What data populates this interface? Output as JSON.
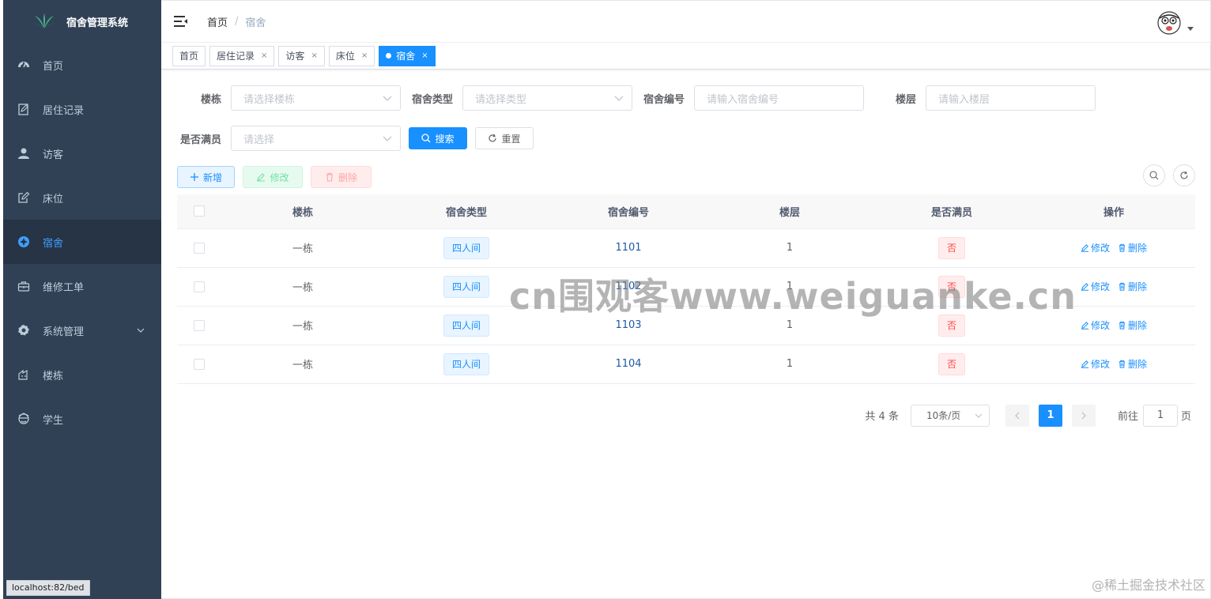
{
  "app": {
    "title": "宿舍管理系统"
  },
  "sidebar": {
    "items": [
      {
        "label": "首页",
        "icon": "dashboard-icon",
        "active": false
      },
      {
        "label": "居住记录",
        "icon": "edit-doc-icon",
        "active": false
      },
      {
        "label": "访客",
        "icon": "user-icon",
        "active": false
      },
      {
        "label": "床位",
        "icon": "edit-icon",
        "active": false
      },
      {
        "label": "宿舍",
        "icon": "dorm-icon",
        "active": true
      },
      {
        "label": "维修工单",
        "icon": "toolbox-icon",
        "active": false
      },
      {
        "label": "系统管理",
        "icon": "gear-icon",
        "active": false,
        "expandable": true
      },
      {
        "label": "楼栋",
        "icon": "building-icon",
        "active": false
      },
      {
        "label": "学生",
        "icon": "student-icon",
        "active": false
      }
    ]
  },
  "status_url": "localhost:82/bed",
  "breadcrumb": {
    "home": "首页",
    "separator": "/",
    "current": "宿舍"
  },
  "tags": [
    {
      "label": "首页",
      "closable": false,
      "active": false
    },
    {
      "label": "居住记录",
      "closable": true,
      "active": false
    },
    {
      "label": "访客",
      "closable": true,
      "active": false
    },
    {
      "label": "床位",
      "closable": true,
      "active": false
    },
    {
      "label": "宿舍",
      "closable": true,
      "active": true
    }
  ],
  "tag_close": "×",
  "search": {
    "building_label": "楼栋",
    "building_placeholder": "请选择楼栋",
    "type_label": "宿舍类型",
    "type_placeholder": "请选择类型",
    "number_label": "宿舍编号",
    "number_placeholder": "请输入宿舍编号",
    "floor_label": "楼层",
    "floor_placeholder": "请输入楼层",
    "full_label": "是否满员",
    "full_placeholder": "请选择",
    "search_btn": "搜索",
    "reset_btn": "重置"
  },
  "toolbar": {
    "add": "新增",
    "edit": "修改",
    "delete": "删除"
  },
  "table": {
    "headers": [
      "楼栋",
      "宿舍类型",
      "宿舍编号",
      "楼层",
      "是否满员",
      "操作"
    ],
    "rows": [
      {
        "building": "一栋",
        "type": "四人间",
        "number": "1101",
        "floor": "1",
        "full": "否"
      },
      {
        "building": "一栋",
        "type": "四人间",
        "number": "1102",
        "floor": "1",
        "full": "否"
      },
      {
        "building": "一栋",
        "type": "四人间",
        "number": "1103",
        "floor": "1",
        "full": "否"
      },
      {
        "building": "一栋",
        "type": "四人间",
        "number": "1104",
        "floor": "1",
        "full": "否"
      }
    ],
    "op_edit": "修改",
    "op_delete": "删除"
  },
  "pagination": {
    "total": "共 4 条",
    "page_size": "10条/页",
    "current": "1",
    "goto_label": "前往",
    "goto_value": "1",
    "goto_suffix": "页"
  },
  "watermark": "cn围观客www.weiguanke.cn",
  "credit": "@稀土掘金技术社区",
  "colors": {
    "sidebar_bg": "#304156",
    "active": "#409eff",
    "primary": "#1890ff",
    "danger": "#ff4949"
  }
}
